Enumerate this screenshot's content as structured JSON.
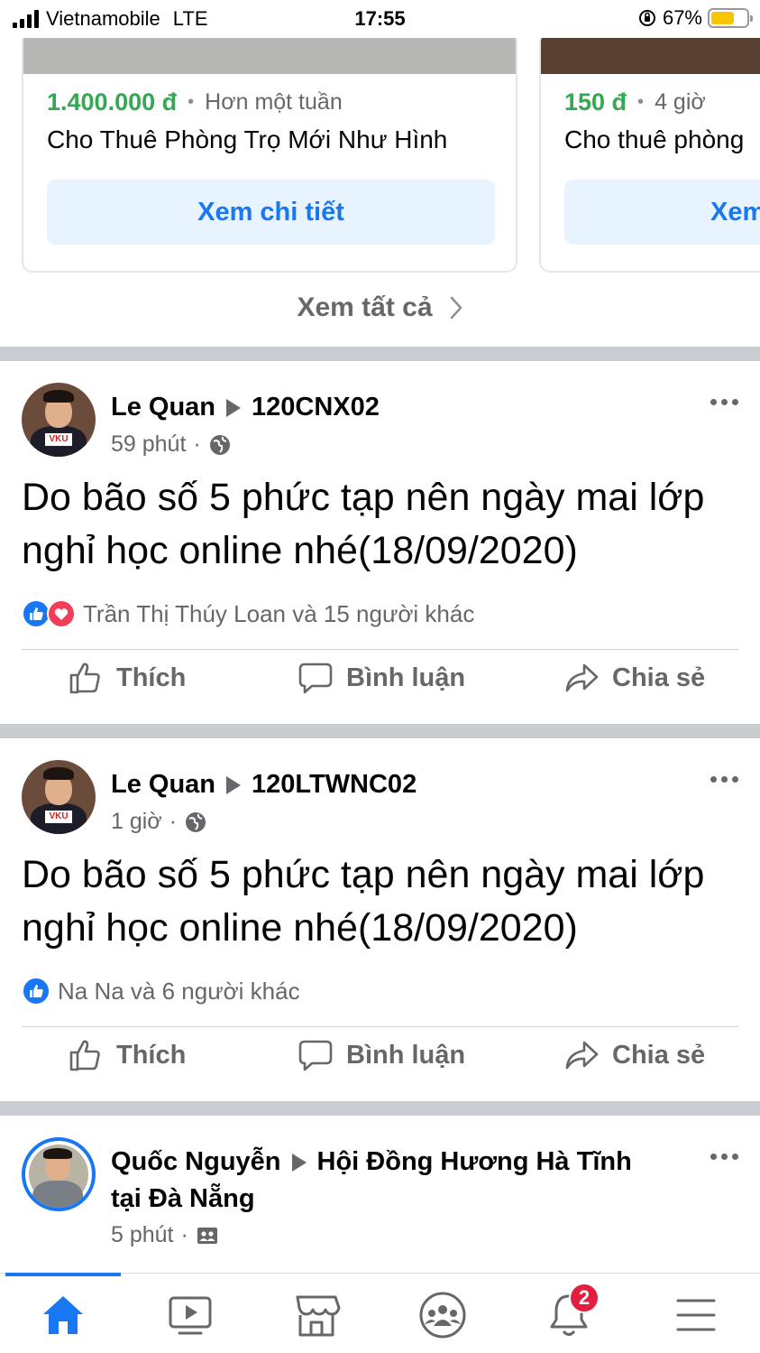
{
  "status_bar": {
    "carrier": "Vietnamobile",
    "network": "LTE",
    "time": "17:55",
    "battery": "67%",
    "battery_level": 0.67
  },
  "marketplace": {
    "cards": [
      {
        "price": "1.400.000 đ",
        "age": "Hơn một tuần",
        "title": "Cho Thuê Phòng Trọ Mới Như Hình",
        "button": "Xem chi tiết"
      },
      {
        "price": "150 đ",
        "age": "4 giờ",
        "title": "Cho thuê phòng",
        "button": "Xem chi tiết"
      }
    ],
    "see_all": "Xem tất cả"
  },
  "posts": [
    {
      "author": "Le Quan",
      "group": "120CNX02",
      "time": "59 phút",
      "privacy_icon": "globe-icon",
      "text": "Do bão số 5 phức tạp nên ngày mai lớp nghỉ học online nhé(18/09/2020)",
      "reactions_text": "Trần Thị Thúy Loan và 15 người khác",
      "reaction_icons": [
        "like-icon",
        "love-icon"
      ]
    },
    {
      "author": "Le Quan",
      "group": "120LTWNC02",
      "time": "1 giờ",
      "privacy_icon": "globe-icon",
      "text": "Do bão số 5 phức tạp nên ngày mai lớp nghỉ học online nhé(18/09/2020)",
      "reactions_text": "Na Na và 6 người khác",
      "reaction_icons": [
        "like-icon"
      ]
    },
    {
      "author": "Quốc Nguyễn",
      "group": "Hội Đồng Hương Hà Tĩnh",
      "group_line2": "tại Đà Nẵng",
      "time": "5 phút",
      "privacy_icon": "members-icon"
    }
  ],
  "actions": {
    "like": "Thích",
    "comment": "Bình luận",
    "share": "Chia sẻ"
  },
  "bottom_nav": {
    "items": [
      "home-icon",
      "watch-icon",
      "marketplace-icon",
      "groups-icon",
      "notifications-icon",
      "menu-icon"
    ],
    "notification_badge": "2",
    "active_color": "#1877f2"
  },
  "colors": {
    "accent": "#1877f2",
    "price_green": "#34a853",
    "secondary_text": "#65676b",
    "divider": "#c9ccd1"
  }
}
